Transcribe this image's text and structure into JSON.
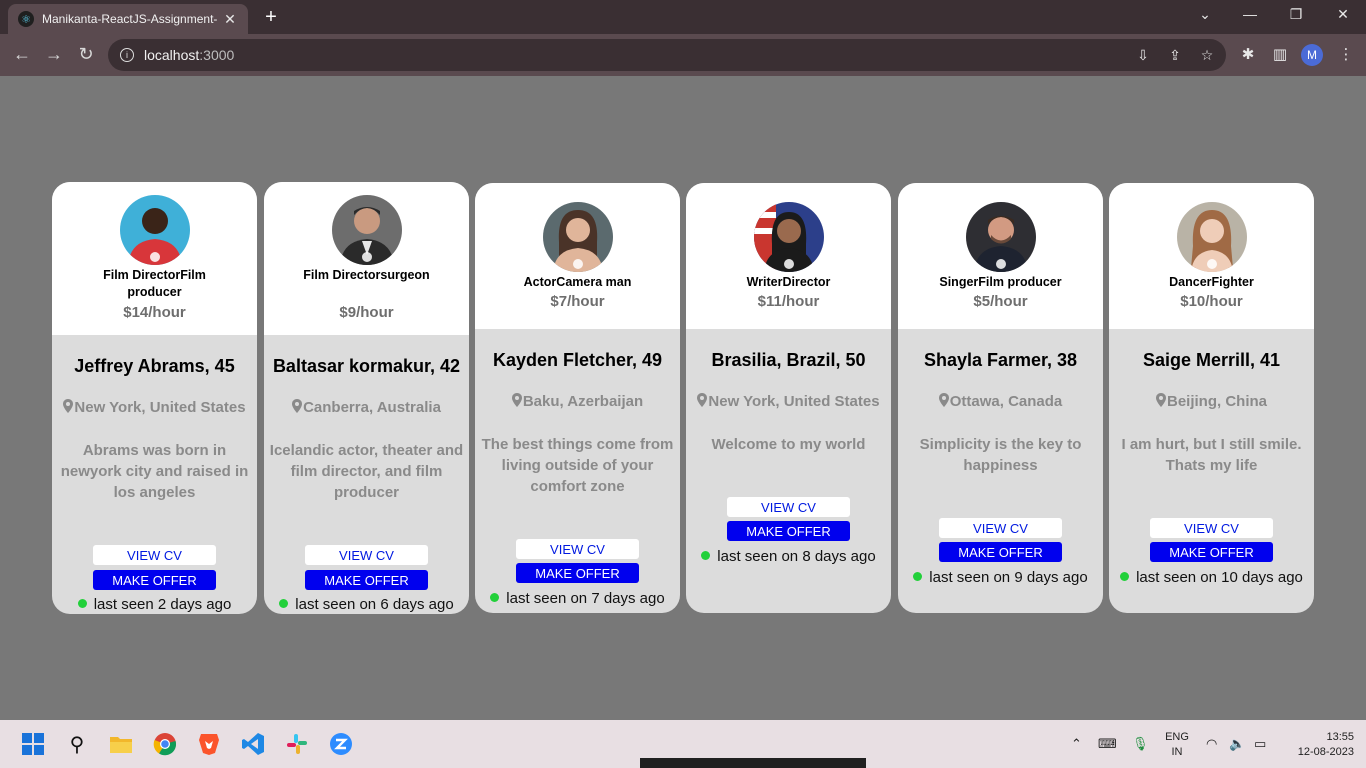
{
  "browser": {
    "tab_title": "Manikanta-ReactJS-Assignment-",
    "tab_close": "✕",
    "new_tab": "+",
    "url_host": "localhost",
    "url_port": ":3000",
    "profile_initial": "M"
  },
  "cards": [
    {
      "profession": "Film DirectorFilm producer",
      "rate": "$14/hour",
      "name": "Jeffrey Abrams, 45",
      "location": "New York, United States",
      "bio": "Abrams was born in newyork city and raised in los angeles",
      "view_cv": "VIEW CV",
      "make_offer": "MAKE OFFER",
      "last_seen": "last seen 2 days ago",
      "avatar_bg": "#3fb0d8",
      "avatar_skin": "#3a2418",
      "avatar_shirt": "#d8363a"
    },
    {
      "profession": "Film Directorsurgeon",
      "rate": "$9/hour",
      "name": "Baltasar kormakur, 42",
      "location": "Canberra, Australia",
      "bio": "Icelandic actor, theater and film director, and film producer",
      "view_cv": "VIEW CV",
      "make_offer": "MAKE OFFER",
      "last_seen": "last seen on 6 days ago",
      "avatar_bg": "#6d6d6d",
      "avatar_skin": "#c99a80",
      "avatar_shirt": "#2a2a2a"
    },
    {
      "profession": "ActorCamera man",
      "rate": "$7/hour",
      "name": "Kayden Fletcher, 49",
      "location": "Baku, Azerbaijan",
      "bio": "The best things come from living outside of your comfort zone",
      "view_cv": "VIEW CV",
      "make_offer": "MAKE OFFER",
      "last_seen": "last seen on 7 days ago",
      "avatar_bg": "#5b6a6e",
      "avatar_skin": "#e0b59a",
      "avatar_shirt": "#4a3328"
    },
    {
      "profession": "WriterDirector",
      "rate": "$11/hour",
      "name": "Brasilia, Brazil, 50",
      "location": "New York, United States",
      "bio": "Welcome to my world",
      "view_cv": "VIEW CV",
      "make_offer": "MAKE OFFER",
      "last_seen": "last seen on 8 days ago",
      "avatar_bg": "#2c3f8a",
      "avatar_skin": "#9a6a4e",
      "avatar_shirt": "#1b1b1b"
    },
    {
      "profession": "SingerFilm producer",
      "rate": "$5/hour",
      "name": "Shayla Farmer, 38",
      "location": "Ottawa, Canada",
      "bio": "Simplicity is the key to happiness",
      "view_cv": "VIEW CV",
      "make_offer": "MAKE OFFER",
      "last_seen": "last seen on 9 days ago",
      "avatar_bg": "#2e2e33",
      "avatar_skin": "#d29a82",
      "avatar_shirt": "#1e2330"
    },
    {
      "profession": "DancerFighter",
      "rate": "$10/hour",
      "name": "Saige Merrill, 41",
      "location": "Beijing, China",
      "bio": "I am hurt, but I still smile. Thats my life",
      "view_cv": "VIEW CV",
      "make_offer": "MAKE OFFER",
      "last_seen": "last seen on 10 days ago",
      "avatar_bg": "#b9b3a6",
      "avatar_skin": "#efcdb8",
      "avatar_shirt": "#a06a45"
    }
  ],
  "taskbar": {
    "language_top": "ENG",
    "language_bottom": "IN",
    "time": "13:55",
    "date": "12-08-2023"
  }
}
